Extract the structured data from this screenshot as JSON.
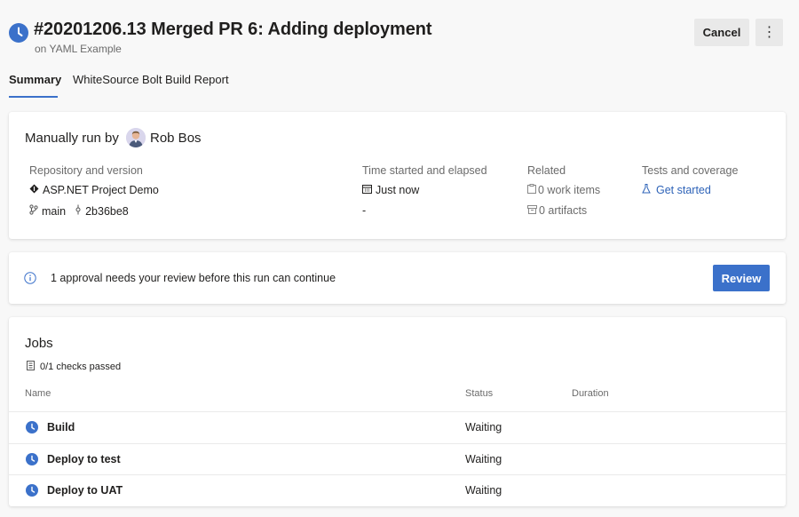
{
  "header": {
    "title": "#20201206.13 Merged PR 6: Adding deployment",
    "subtitle": "on YAML Example",
    "cancel_label": "Cancel",
    "more_label": "⋮"
  },
  "tabs": [
    {
      "label": "Summary",
      "active": true
    },
    {
      "label": "WhiteSource Bolt Build Report",
      "active": false
    }
  ],
  "run": {
    "title": "Manually run by",
    "user": "Rob Bos",
    "repo_label": "Repository and version",
    "repo_name": "ASP.NET Project Demo",
    "branch": "main",
    "commit": "2b36be8",
    "time_label": "Time started and elapsed",
    "time_started": "Just now",
    "elapsed": "-",
    "related_label": "Related",
    "work_items": "0 work items",
    "artifacts": "0 artifacts",
    "tests_label": "Tests and coverage",
    "tests_link": "Get started"
  },
  "approval": {
    "message": "1 approval needs your review before this run can continue",
    "review_label": "Review"
  },
  "jobs": {
    "title": "Jobs",
    "checks": "0/1 checks passed",
    "columns": {
      "name": "Name",
      "status": "Status",
      "duration": "Duration"
    },
    "rows": [
      {
        "name": "Build",
        "status": "Waiting"
      },
      {
        "name": "Deploy to test",
        "status": "Waiting"
      },
      {
        "name": "Deploy to UAT",
        "status": "Waiting"
      }
    ]
  },
  "colors": {
    "accent": "#3b71ca",
    "link": "#2e63b8",
    "muted_text": "#6b6b6b"
  },
  "icons": [
    "clock-icon",
    "more-icon",
    "avatar",
    "repo-icon",
    "branch-icon",
    "commit-icon",
    "calendar-icon",
    "work-item-icon",
    "artifact-icon",
    "flask-icon",
    "info-icon",
    "checklist-icon"
  ]
}
